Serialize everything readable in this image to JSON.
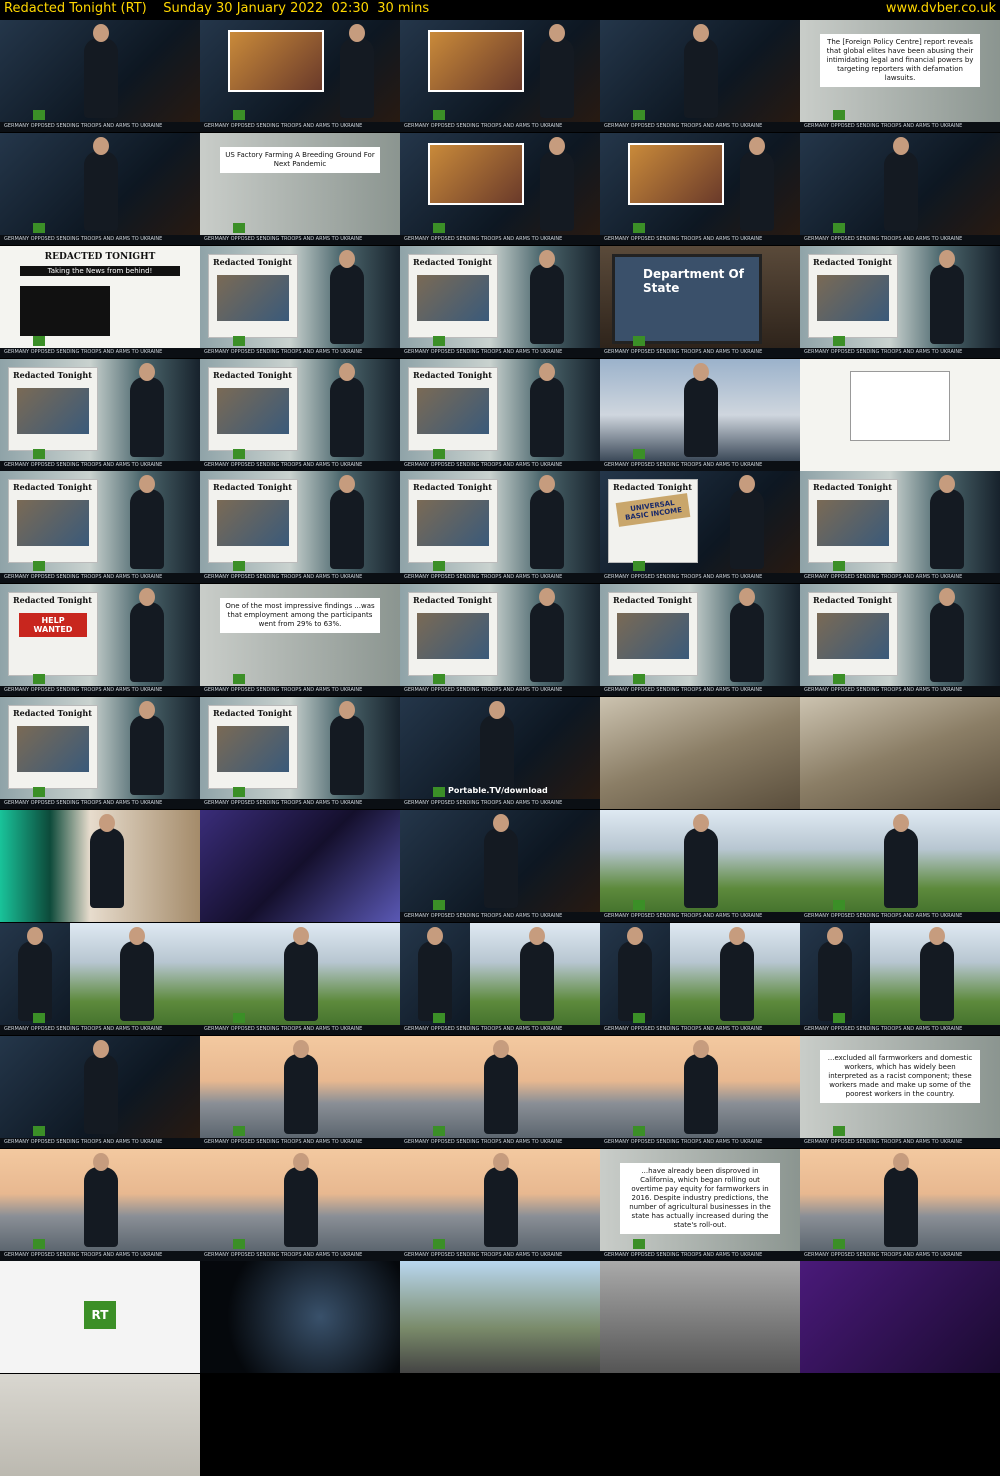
{
  "header": {
    "title": "Redacted Tonight (RT)",
    "date": "Sunday 30 January 2022",
    "time": "02:30",
    "duration": "30 mins",
    "site": "www.dvber.co.uk"
  },
  "texts": {
    "quote_policy": "The [Foreign Policy Centre] report reveals that global elites have been abusing their intimidating legal and financial powers by targeting reporters with defamation lawsuits.",
    "quote_factory": "US Factory Farming A Breeding Ground For Next Pandemic",
    "quote_findings": "One of the most impressive findings ...was that employment among the participants went from 29% to 63%.",
    "quote_farmworkers": "...excluded all farmworkers and domestic workers, which has widely been interpreted as a racist component; these workers made and make up some of the poorest workers in the country.",
    "quote_california": "...have already been disproved in California, which began rolling out overtime pay equity for farmworkers in 2016. Despite industry predictions, the number of agricultural businesses in the state has actually increased during the state's roll-out.",
    "show_logo": "Redacted Tonight",
    "dept_state": "Department Of State",
    "ubi": "UNIVERSAL BASIC INCOME",
    "help_wanted": "HELP WANTED",
    "portable": "Portable.TV/download",
    "rt_logo": "RT",
    "paper_title": "REDACTED TONIGHT",
    "paper_sub": "Taking the News from behind!",
    "ticker": "GERMANY OPPOSED SENDING TROOPS AND ARMS TO UKRAINE"
  },
  "colors": {
    "header_text": "#ffd700",
    "background": "#000000",
    "rt_green": "#3b8f27"
  }
}
